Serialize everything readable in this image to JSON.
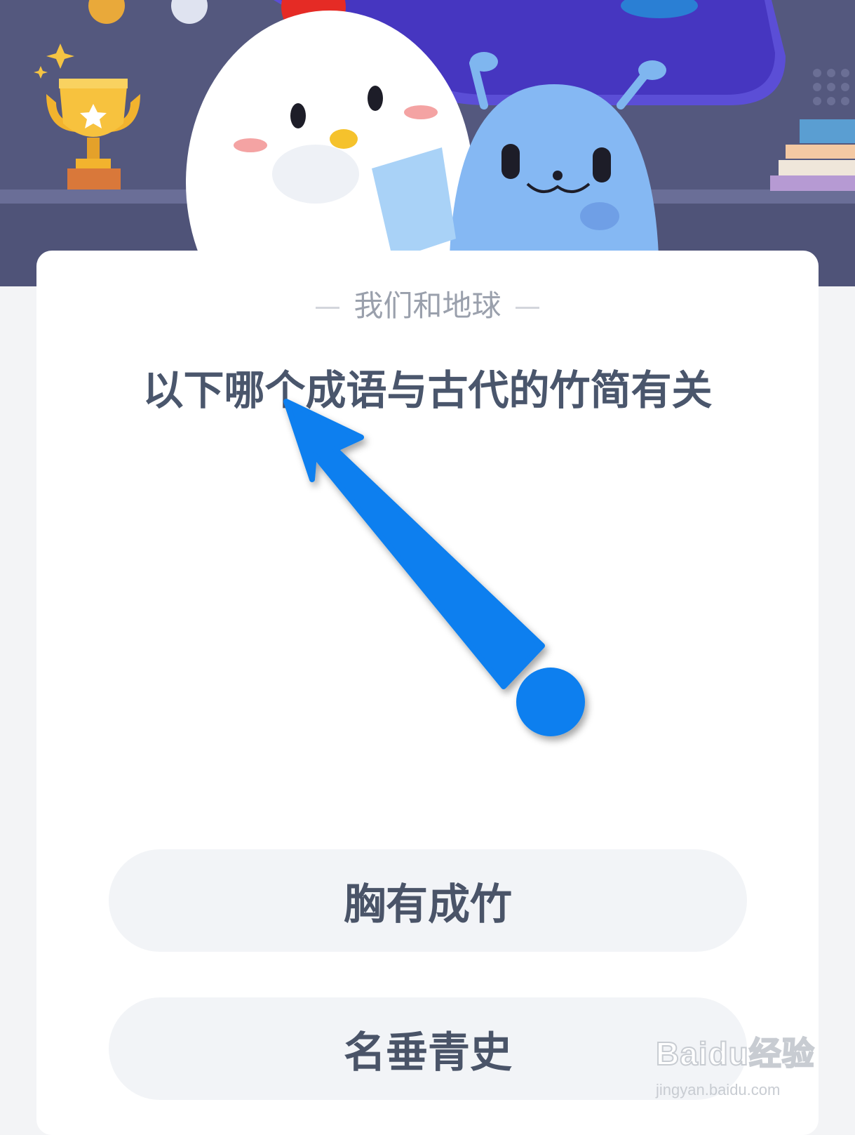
{
  "quiz": {
    "topic": "我们和地球",
    "question": "以下哪个成语与古代的竹简有关",
    "options": [
      {
        "label": "胸有成竹"
      },
      {
        "label": "名垂青史"
      }
    ]
  },
  "watermark": {
    "logo": "Baidu经验",
    "url": "jingyan.baidu.com"
  },
  "colors": {
    "banner_bg": "#54587e",
    "pointer_arrow": "#0a7fef",
    "question_text": "#4a566c"
  },
  "icons": [
    "trophy-icon",
    "chicken-mascot",
    "alien-mascot",
    "books-icon",
    "arrow-pointer-icon"
  ]
}
